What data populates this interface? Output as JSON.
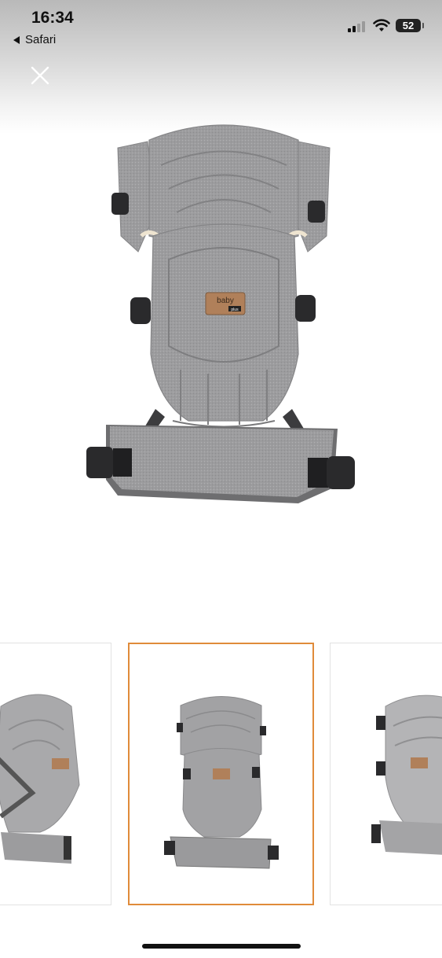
{
  "status_bar": {
    "time": "16:34",
    "back_app": "Safari",
    "battery": "52"
  },
  "gallery": {
    "main_image": {
      "label_line1": "baby",
      "label_line2": "plus"
    },
    "thumbnails": [
      {
        "selected": false
      },
      {
        "selected": true
      },
      {
        "selected": false
      }
    ],
    "accent_color": "#e08b3a"
  }
}
